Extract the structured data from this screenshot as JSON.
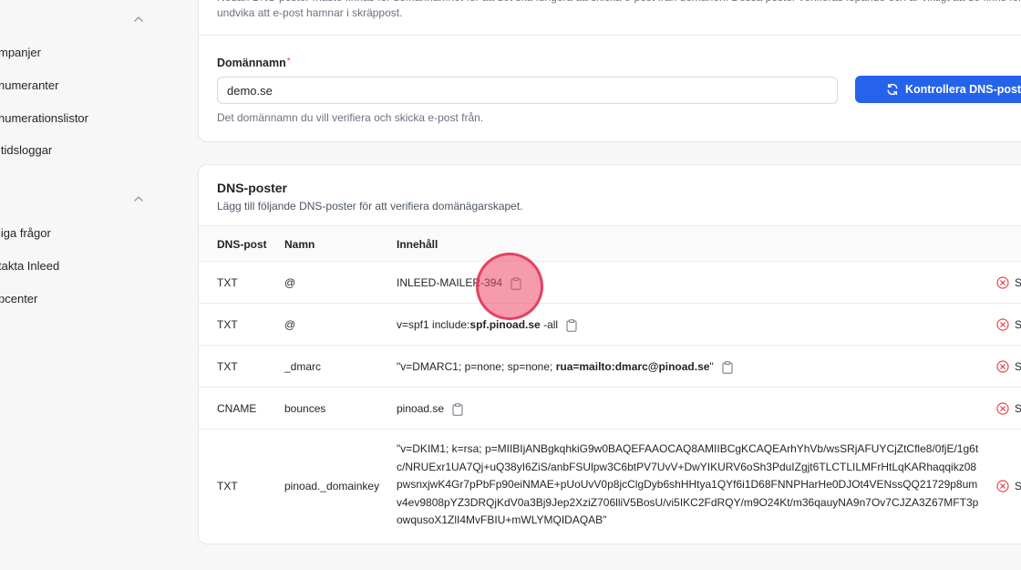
{
  "sidebar": {
    "group1_items": [
      {
        "label": "mpanjer"
      },
      {
        "label": "numeranter"
      },
      {
        "label": "numerationslistor"
      },
      {
        "label": "ltidsloggar"
      }
    ],
    "group2_items": [
      {
        "label": "liga frågor"
      },
      {
        "label": "takta Inleed"
      },
      {
        "label": "pcenter"
      }
    ]
  },
  "domain_card": {
    "intro_text": "Nedan DNS-poster måste finnas för domännamnet för att det ska fungera att skicka e-post från domänen. Dessa poster verifieras löpande och är viktigt att de finns för att undvika att e-post hamnar i skräppost.",
    "field_label": "Domännamn",
    "required_mark": "*",
    "domain_value": "demo.se",
    "help_text": "Det domännamn du vill verifiera och skicka e-post från.",
    "verify_button_label": "Kontrollera DNS-poster"
  },
  "dns_card": {
    "title": "DNS-poster",
    "subtitle": "Lägg till följande DNS-poster för att verifiera domänägarskapet.",
    "columns": {
      "type": "DNS-post",
      "name": "Namn",
      "content": "Innehåll"
    },
    "rows": [
      {
        "type": "TXT",
        "name": "@",
        "content_pre": "INLEED-MAILER-394",
        "content_bold": "",
        "content_post": "",
        "status": "S"
      },
      {
        "type": "TXT",
        "name": "@",
        "content_pre": "v=spf1 include:",
        "content_bold": "spf.pinoad.se",
        "content_post": " -all",
        "status": "S"
      },
      {
        "type": "TXT",
        "name": "_dmarc",
        "content_pre": "\"v=DMARC1; p=none; sp=none; ",
        "content_bold": "rua=mailto:dmarc@pinoad.se",
        "content_post": "\"",
        "status": "S"
      },
      {
        "type": "CNAME",
        "name": "bounces",
        "content_pre": "pinoad.se",
        "content_bold": "",
        "content_post": "",
        "status": "S"
      },
      {
        "type": "TXT",
        "name": "pinoad._domainkey",
        "content_long": "\"v=DKIM1; k=rsa; p=MIIBIjANBgkqhkiG9w0BAQEFAAOCAQ8AMIIBCgKCAQEArhYhVb/wsSRjAFUYCjZtCfle8/0fjE/1g6tc/NRUExr1UA7Qj+uQ38yI6ZiS/anbFSUlpw3C6btPV7UvV+DwYIKURV6oSh3PduIZgjt6TLCTLILMFrHtLqKARhaqqikz08pwsnxjwK4Gr7pPbFp90eiNMAE+pUoUvV0p8jcClgDyb6shHHtya1QYf6i1D68FNNPHarHe0DJOt4VENssQQ21729p8umv4ev9808pYZ3DRQjKdV0a3Bj9Jep2XziZ706lliV5BosU/vi5IKC2FdRQY/m9O24Kt/m36qauyNA9n7Ov7CJZA3Z67MFT3powqusoX1ZlI4MvFBIU+mWLYMQIDAQAB\"",
        "status": "S"
      }
    ]
  },
  "colors": {
    "primary": "#2563eb",
    "error": "#e5484d",
    "click_marker": "#ec4864"
  }
}
